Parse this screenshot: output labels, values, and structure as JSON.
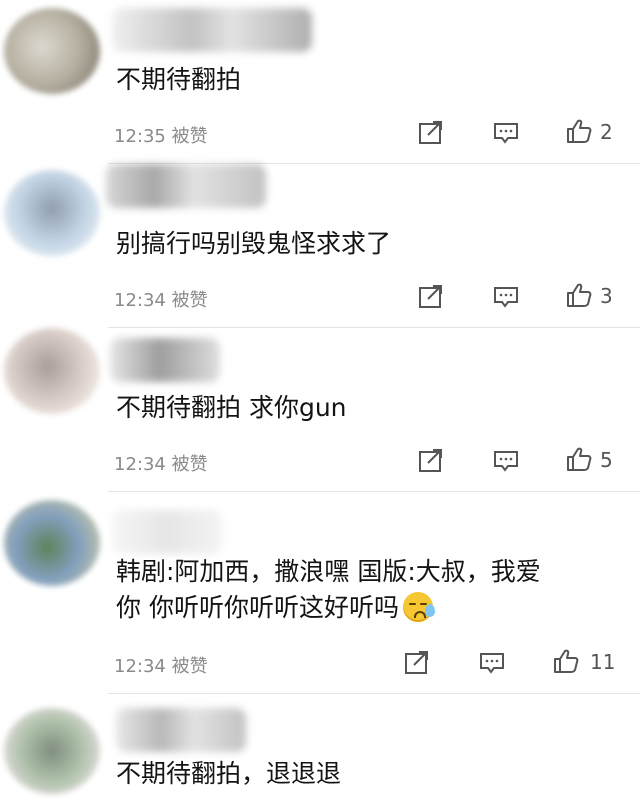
{
  "comments": [
    {
      "text": "不期待翻拍",
      "time": "12:35",
      "liked_label": "被赞",
      "likes": "2"
    },
    {
      "text": "别搞行吗别毁鬼怪求求了",
      "time": "12:34",
      "liked_label": "被赞",
      "likes": "3"
    },
    {
      "text": "不期待翻拍 求你gun",
      "time": "12:34",
      "liked_label": "被赞",
      "likes": "5"
    },
    {
      "text_line1": "韩剧:阿加西，撒浪嘿 国版:大叔，我爱",
      "text_line2": "你 你听听你听听这好听吗",
      "time": "12:34",
      "liked_label": "被赞",
      "likes": "11"
    },
    {
      "text": "不期待翻拍，退退退"
    }
  ],
  "icons": {
    "share": "share-icon",
    "reply": "comment-icon",
    "like": "thumbs-up-icon",
    "emoji": "sweat-smile-emoji"
  },
  "colors": {
    "meta": "#8a8a8a",
    "divider": "#e3e3e3",
    "text": "#141414"
  }
}
